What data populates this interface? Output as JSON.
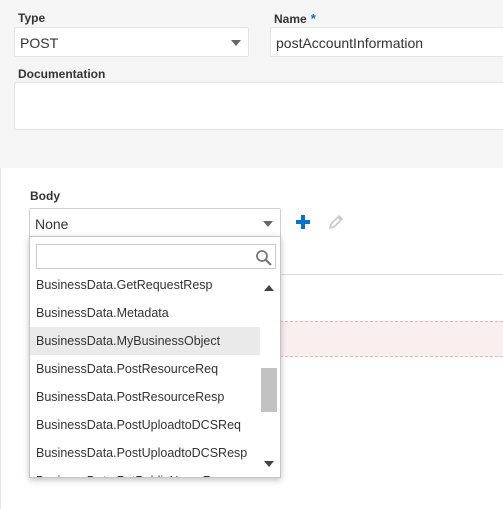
{
  "type_field": {
    "label": "Type",
    "value": "POST"
  },
  "name_field": {
    "label": "Name",
    "required_mark": "*",
    "value": "postAccountInformation"
  },
  "documentation": {
    "label": "Documentation",
    "value": ""
  },
  "body": {
    "label": "Body",
    "selected": "None",
    "add_icon": "plus-icon",
    "edit_icon": "pencil-icon"
  },
  "dropdown": {
    "search_placeholder": "",
    "search_icon": "search-icon",
    "options": [
      {
        "label": "BusinessData.GetRequestResp"
      },
      {
        "label": "BusinessData.Metadata"
      },
      {
        "label": "BusinessData.MyBusinessObject"
      },
      {
        "label": "BusinessData.PostResourceReq"
      },
      {
        "label": "BusinessData.PostResourceResp"
      },
      {
        "label": "BusinessData.PostUploadtoDCSReq"
      },
      {
        "label": "BusinessData.PostUploadtoDCSResp"
      },
      {
        "label": "BusinessData.PutPublicNameResp"
      }
    ],
    "selected_index": 2
  },
  "colors": {
    "accent": "#0572ce",
    "highlight": "#eaeaea",
    "error_row": "#fbeeee"
  }
}
